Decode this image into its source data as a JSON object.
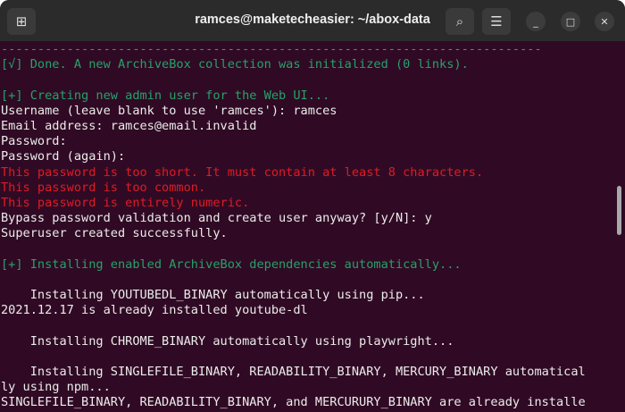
{
  "window": {
    "title": "ramces@maketecheasier: ~/abox-data",
    "new_tab_icon": "new-tab-icon",
    "search_icon": "search-icon",
    "menu_icon": "hamburger-menu-icon",
    "minimize": "_",
    "maximize": "□",
    "close": "✕"
  },
  "colors": {
    "background": "#300a24",
    "green": "#26a269",
    "red": "#e01b24",
    "header": "#2b2b2b"
  },
  "terminal": {
    "lines": [
      {
        "text": "--------------------------------------------------------------------------",
        "style": "g"
      },
      {
        "text": "[√] Done. A new ArchiveBox collection was initialized (0 links).",
        "style": "g"
      },
      {
        "text": "",
        "style": ""
      },
      {
        "text": "[+] Creating new admin user for the Web UI...",
        "style": "g"
      },
      {
        "text": "Username (leave blank to use 'ramces'): ramces",
        "style": ""
      },
      {
        "text": "Email address: ramces@email.invalid",
        "style": ""
      },
      {
        "text": "Password:",
        "style": ""
      },
      {
        "text": "Password (again):",
        "style": ""
      },
      {
        "text": "This password is too short. It must contain at least 8 characters.",
        "style": "r"
      },
      {
        "text": "This password is too common.",
        "style": "r"
      },
      {
        "text": "This password is entirely numeric.",
        "style": "r"
      },
      {
        "text": "Bypass password validation and create user anyway? [y/N]: y",
        "style": ""
      },
      {
        "text": "Superuser created successfully.",
        "style": ""
      },
      {
        "text": "",
        "style": ""
      },
      {
        "text": "[+] Installing enabled ArchiveBox dependencies automatically...",
        "style": "g"
      },
      {
        "text": "",
        "style": ""
      },
      {
        "text": "    Installing YOUTUBEDL_BINARY automatically using pip...",
        "style": ""
      },
      {
        "text": "2021.12.17 is already installed youtube-dl",
        "style": ""
      },
      {
        "text": "",
        "style": ""
      },
      {
        "text": "    Installing CHROME_BINARY automatically using playwright...",
        "style": ""
      },
      {
        "text": "",
        "style": ""
      },
      {
        "text": "    Installing SINGLEFILE_BINARY, READABILITY_BINARY, MERCURY_BINARY automatical",
        "style": ""
      },
      {
        "text": "ly using npm...",
        "style": ""
      },
      {
        "text": "SINGLEFILE_BINARY, READABILITY_BINARY, and MERCURURY_BINARY are already installe",
        "style": ""
      }
    ]
  }
}
